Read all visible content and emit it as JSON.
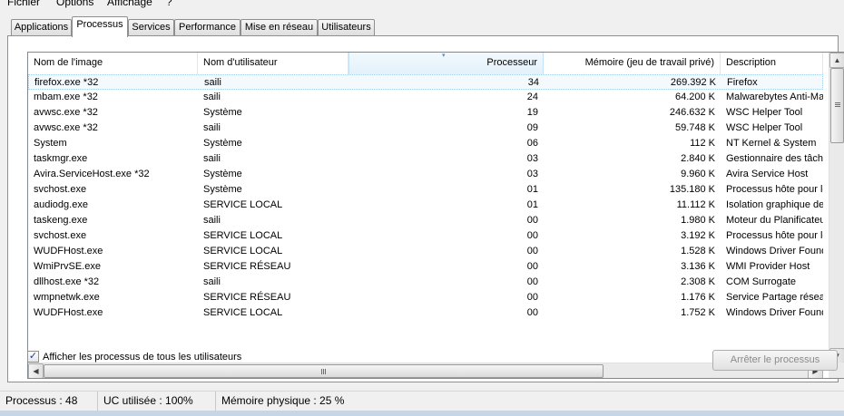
{
  "menu": [
    "Fichier",
    "Options",
    "Affichage",
    "?"
  ],
  "tabs": [
    "Applications",
    "Processus",
    "Services",
    "Performance",
    "Mise en réseau",
    "Utilisateurs"
  ],
  "active_tab": "Processus",
  "columns": {
    "image": "Nom de l'image",
    "user": "Nom d'utilisateur",
    "cpu": "Processeur",
    "memory": "Mémoire (jeu de travail privé)",
    "description": "Description"
  },
  "rows": [
    {
      "image": "firefox.exe *32",
      "user": "saili",
      "cpu": "34",
      "memory": "269.392 K",
      "description": "Firefox"
    },
    {
      "image": "mbam.exe *32",
      "user": "saili",
      "cpu": "24",
      "memory": "64.200 K",
      "description": "Malwarebytes Anti-Ma"
    },
    {
      "image": "avwsc.exe *32",
      "user": "Système",
      "cpu": "19",
      "memory": "246.632 K",
      "description": "WSC Helper Tool"
    },
    {
      "image": "avwsc.exe *32",
      "user": "saili",
      "cpu": "09",
      "memory": "59.748 K",
      "description": "WSC Helper Tool"
    },
    {
      "image": "System",
      "user": "Système",
      "cpu": "06",
      "memory": "112 K",
      "description": "NT Kernel & System"
    },
    {
      "image": "taskmgr.exe",
      "user": "saili",
      "cpu": "03",
      "memory": "2.840 K",
      "description": "Gestionnaire des tâche"
    },
    {
      "image": "Avira.ServiceHost.exe *32",
      "user": "Système",
      "cpu": "03",
      "memory": "9.960 K",
      "description": "Avira Service Host"
    },
    {
      "image": "svchost.exe",
      "user": "Système",
      "cpu": "01",
      "memory": "135.180 K",
      "description": "Processus hôte pour le"
    },
    {
      "image": "audiodg.exe",
      "user": "SERVICE LOCAL",
      "cpu": "01",
      "memory": "11.112 K",
      "description": "Isolation graphique de"
    },
    {
      "image": "taskeng.exe",
      "user": "saili",
      "cpu": "00",
      "memory": "1.980 K",
      "description": "Moteur du Planificateu"
    },
    {
      "image": "svchost.exe",
      "user": "SERVICE LOCAL",
      "cpu": "00",
      "memory": "3.192 K",
      "description": "Processus hôte pour le"
    },
    {
      "image": "WUDFHost.exe",
      "user": "SERVICE LOCAL",
      "cpu": "00",
      "memory": "1.528 K",
      "description": "Windows Driver Found"
    },
    {
      "image": "WmiPrvSE.exe",
      "user": "SERVICE RÉSEAU",
      "cpu": "00",
      "memory": "3.136 K",
      "description": "WMI Provider Host"
    },
    {
      "image": "dllhost.exe *32",
      "user": "saili",
      "cpu": "00",
      "memory": "2.308 K",
      "description": "COM Surrogate"
    },
    {
      "image": "wmpnetwk.exe",
      "user": "SERVICE RÉSEAU",
      "cpu": "00",
      "memory": "1.176 K",
      "description": "Service Partage résea"
    },
    {
      "image": "WUDFHost.exe",
      "user": "SERVICE LOCAL",
      "cpu": "00",
      "memory": "1.752 K",
      "description": "Windows Driver Found"
    }
  ],
  "show_all_label": "Afficher les processus de tous les utilisateurs",
  "show_all_checked": true,
  "end_process_label": "Arrêter le processus",
  "status": {
    "processes": "Processus : 48",
    "cpu": "UC utilisée : 100%",
    "memory": "Mémoire physique : 25 %"
  },
  "icons": {
    "checkbox_check": "✓",
    "sort_arrow": "▾",
    "scroll_up": "▲",
    "scroll_down": "▼",
    "scroll_left": "◀",
    "scroll_right": "▶"
  }
}
